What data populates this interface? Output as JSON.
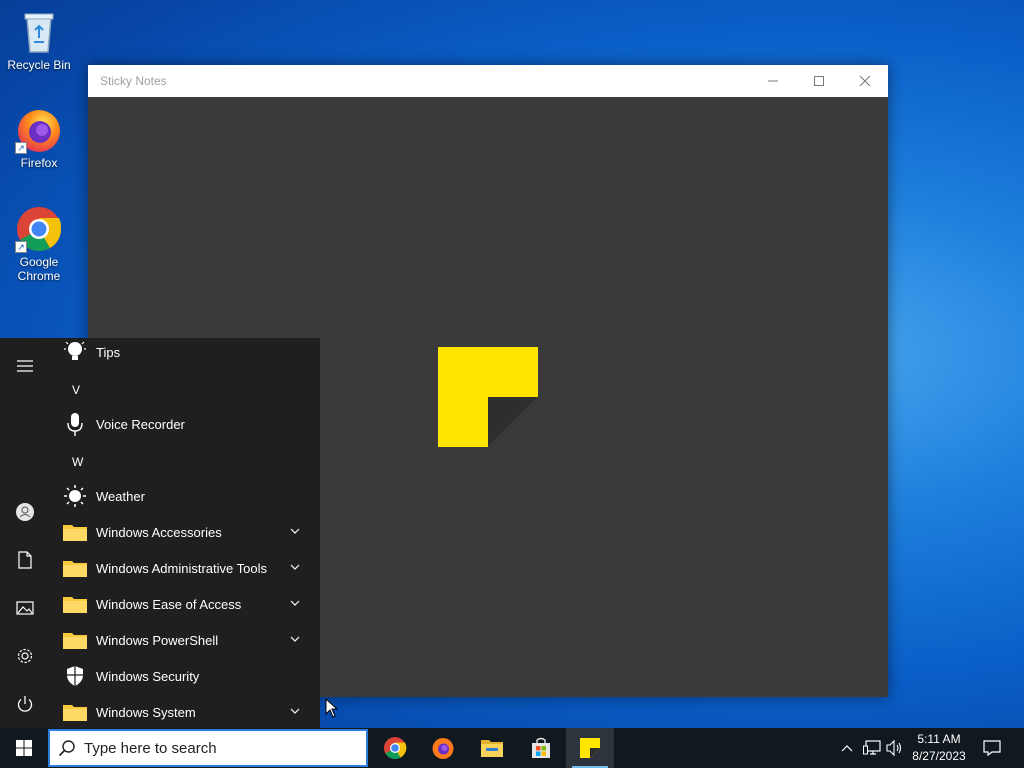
{
  "desktop": {
    "icons": [
      {
        "label": "Recycle Bin",
        "icon": "recycle-bin-icon"
      },
      {
        "label": "Firefox",
        "icon": "firefox-icon"
      },
      {
        "label": "Google Chrome",
        "icon": "chrome-icon"
      }
    ]
  },
  "window": {
    "title": "Sticky Notes",
    "minimize_icon": "minimize-icon",
    "maximize_icon": "maximize-icon",
    "close_icon": "close-icon",
    "logo_color": "#FFE500"
  },
  "start_menu": {
    "rail": [
      {
        "icon": "hamburger-menu-icon"
      },
      {
        "icon": "user-account-icon"
      },
      {
        "icon": "documents-icon"
      },
      {
        "icon": "pictures-icon"
      },
      {
        "icon": "settings-gear-icon"
      },
      {
        "icon": "power-icon"
      }
    ],
    "letters": {
      "v": "V",
      "w": "W"
    },
    "apps": [
      {
        "label": "Tips",
        "icon": "lightbulb-icon",
        "expandable": false
      },
      {
        "label": "Voice Recorder",
        "icon": "microphone-icon",
        "expandable": false
      },
      {
        "label": "Weather",
        "icon": "sun-icon",
        "expandable": false
      },
      {
        "label": "Windows Accessories",
        "icon": "folder-icon",
        "expandable": true
      },
      {
        "label": "Windows Administrative Tools",
        "icon": "folder-icon",
        "expandable": true
      },
      {
        "label": "Windows Ease of Access",
        "icon": "folder-icon",
        "expandable": true
      },
      {
        "label": "Windows PowerShell",
        "icon": "folder-icon",
        "expandable": true
      },
      {
        "label": "Windows Security",
        "icon": "shield-icon",
        "expandable": false
      },
      {
        "label": "Windows System",
        "icon": "folder-icon",
        "expandable": true
      }
    ]
  },
  "taskbar": {
    "search_placeholder": "Type here to search",
    "pinned": [
      {
        "icon": "chrome-icon",
        "active": false
      },
      {
        "icon": "firefox-icon",
        "active": false
      },
      {
        "icon": "file-explorer-icon",
        "active": false
      },
      {
        "icon": "microsoft-store-icon",
        "active": false
      },
      {
        "icon": "sticky-notes-icon",
        "active": true
      }
    ],
    "tray": {
      "time": "5:11 AM",
      "date": "8/27/2023",
      "icons": [
        "show-hidden-icons-chevron-icon",
        "network-icon",
        "volume-icon",
        "action-center-icon"
      ]
    }
  },
  "colors": {
    "accent": "#2b7fd8",
    "start_bg": "#1f1f1f",
    "taskbar_bg": "#101820",
    "folder_yellow": "#F8C93E"
  }
}
